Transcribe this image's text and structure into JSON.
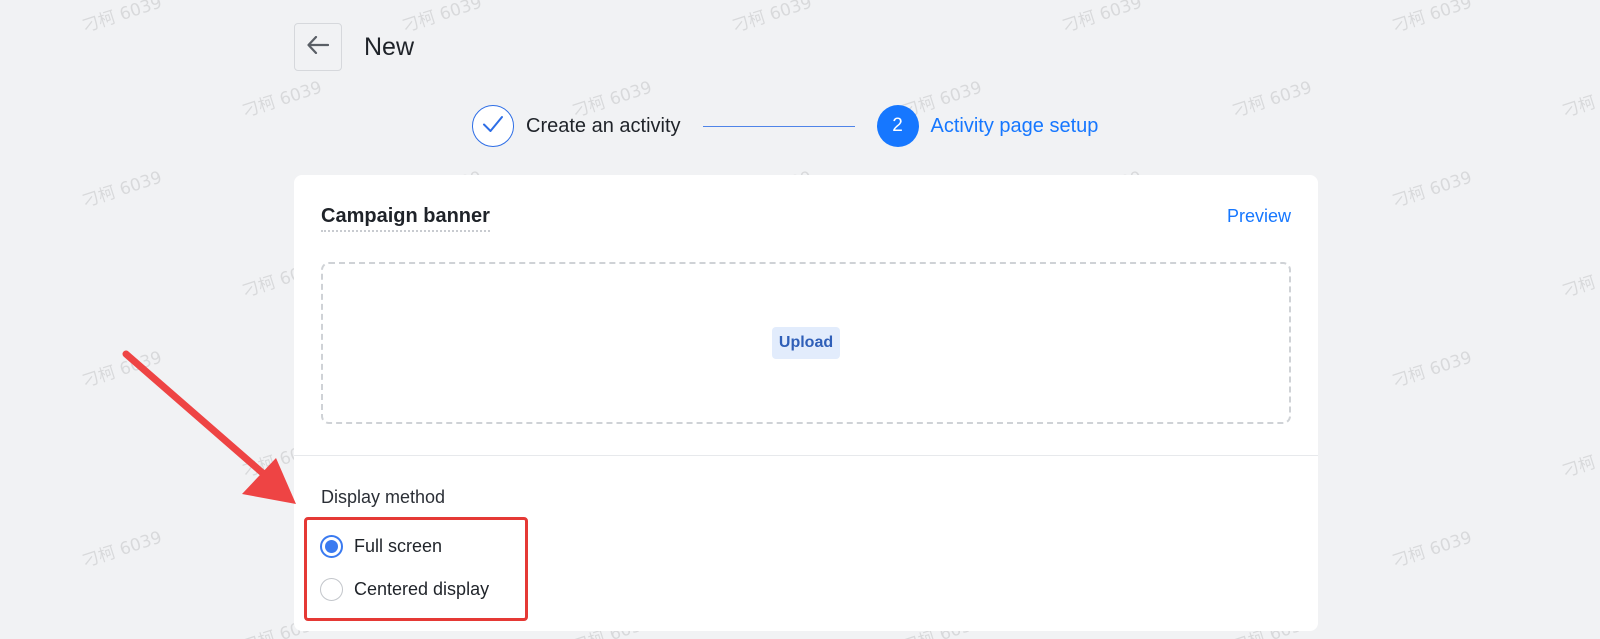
{
  "header": {
    "title": "New"
  },
  "steps": [
    {
      "label": "Create an activity",
      "status": "done"
    },
    {
      "number": "2",
      "label": "Activity page setup",
      "status": "active"
    }
  ],
  "card": {
    "section_title": "Campaign banner",
    "preview_label": "Preview",
    "upload_label": "Upload",
    "display_method": {
      "label": "Display method",
      "options": [
        {
          "label": "Full screen",
          "checked": true
        },
        {
          "label": "Centered display",
          "checked": false
        }
      ]
    }
  },
  "watermark": "刁柯 6039",
  "colors": {
    "accent": "#1677ff",
    "annotation": "#e53935",
    "background": "#f1f2f4"
  },
  "icons": {
    "back": "arrow-left-icon",
    "step_done": "check-icon"
  }
}
